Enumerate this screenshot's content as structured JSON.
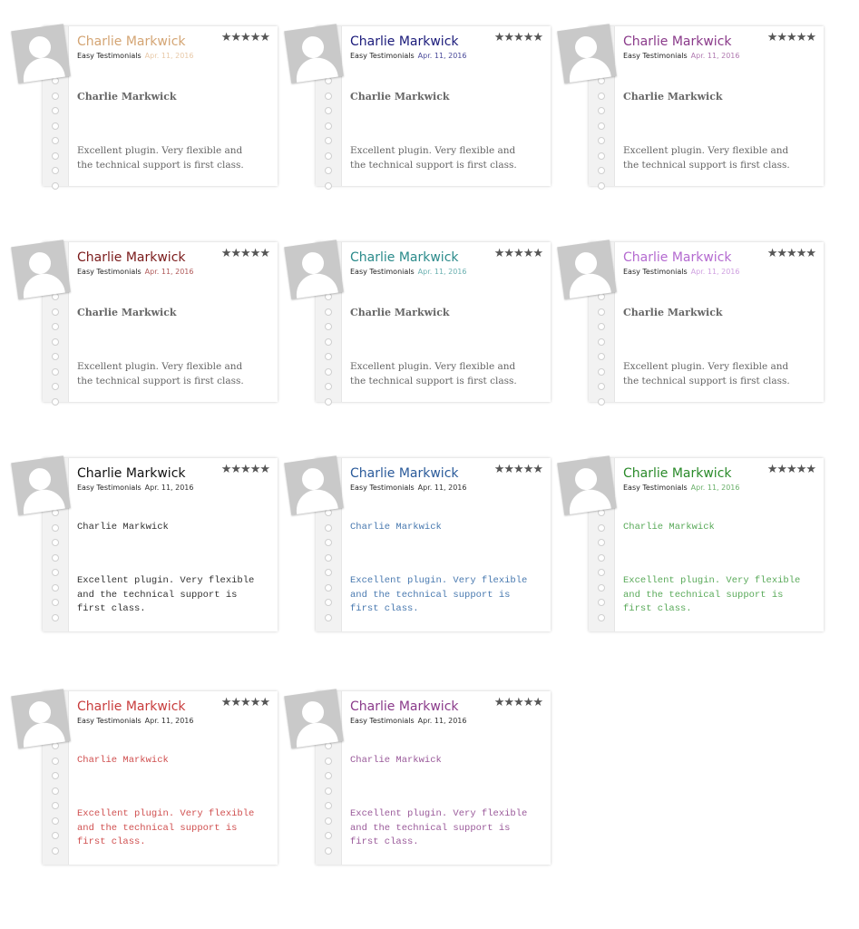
{
  "testimonials": [
    {
      "author": "Charlie Markwick",
      "source": "Easy Testimonials",
      "date": "Apr. 11, 2016",
      "rating": 5,
      "title": "Charlie Markwick",
      "body": "Excellent plugin. Very flexible and the technical support is first class.",
      "name_color": "#d4a574",
      "date_color": "#e8c9a8",
      "text_color": "#666666",
      "font": "serif"
    },
    {
      "author": "Charlie Markwick",
      "source": "Easy Testimonials",
      "date": "Apr. 11, 2016",
      "rating": 5,
      "title": "Charlie Markwick",
      "body": "Excellent plugin. Very flexible and the technical support is first class.",
      "name_color": "#1a1a7a",
      "date_color": "#4a4a9a",
      "text_color": "#666666",
      "font": "serif"
    },
    {
      "author": "Charlie Markwick",
      "source": "Easy Testimonials",
      "date": "Apr. 11, 2016",
      "rating": 5,
      "title": "Charlie Markwick",
      "body": "Excellent plugin. Very flexible and the technical support is first class.",
      "name_color": "#8a3a8a",
      "date_color": "#b07ab0",
      "text_color": "#666666",
      "font": "serif"
    },
    {
      "author": "Charlie Markwick",
      "source": "Easy Testimonials",
      "date": "Apr. 11, 2016",
      "rating": 5,
      "title": "Charlie Markwick",
      "body": "Excellent plugin. Very flexible and the technical support is first class.",
      "name_color": "#7a1a1a",
      "date_color": "#b05a5a",
      "text_color": "#666666",
      "font": "serif"
    },
    {
      "author": "Charlie Markwick",
      "source": "Easy Testimonials",
      "date": "Apr. 11, 2016",
      "rating": 5,
      "title": "Charlie Markwick",
      "body": "Excellent plugin. Very flexible and the technical support is first class.",
      "name_color": "#2a8a8a",
      "date_color": "#6ab0b0",
      "text_color": "#666666",
      "font": "serif"
    },
    {
      "author": "Charlie Markwick",
      "source": "Easy Testimonials",
      "date": "Apr. 11, 2016",
      "rating": 5,
      "title": "Charlie Markwick",
      "body": "Excellent plugin. Very flexible and the technical support is first class.",
      "name_color": "#b46ad0",
      "date_color": "#cfa0e0",
      "text_color": "#666666",
      "font": "serif"
    },
    {
      "author": "Charlie Markwick",
      "source": "Easy Testimonials",
      "date": "Apr. 11, 2016",
      "rating": 5,
      "title": "Charlie Markwick",
      "body": "Excellent plugin. Very flexible and the technical support is first class.",
      "name_color": "#111111",
      "date_color": "#333333",
      "text_color": "#333333",
      "font": "mono"
    },
    {
      "author": "Charlie Markwick",
      "source": "Easy Testimonials",
      "date": "Apr. 11, 2016",
      "rating": 5,
      "title": "Charlie Markwick",
      "body": "Excellent plugin. Very flexible and the technical support is first class.",
      "name_color": "#2a5a9a",
      "date_color": "#333333",
      "text_color": "#4a7ab0",
      "font": "mono"
    },
    {
      "author": "Charlie Markwick",
      "source": "Easy Testimonials",
      "date": "Apr. 11, 2016",
      "rating": 5,
      "title": "Charlie Markwick",
      "body": "Excellent plugin. Very flexible and the technical support is first class.",
      "name_color": "#2a8a2a",
      "date_color": "#6ab06a",
      "text_color": "#5aaa5a",
      "font": "mono"
    },
    {
      "author": "Charlie Markwick",
      "source": "Easy Testimonials",
      "date": "Apr. 11, 2016",
      "rating": 5,
      "title": "Charlie Markwick",
      "body": "Excellent plugin. Very flexible and the technical support is first class.",
      "name_color": "#c83c3c",
      "date_color": "#333333",
      "text_color": "#d05050",
      "font": "mono"
    },
    {
      "author": "Charlie Markwick",
      "source": "Easy Testimonials",
      "date": "Apr. 11, 2016",
      "rating": 5,
      "title": "Charlie Markwick",
      "body": "Excellent plugin. Very flexible and the technical support is first class.",
      "name_color": "#8a3a8a",
      "date_color": "#333333",
      "text_color": "#9a5a9a",
      "font": "mono"
    }
  ],
  "icons": {
    "avatar": "avatar-placeholder-icon",
    "star": "star-icon"
  }
}
